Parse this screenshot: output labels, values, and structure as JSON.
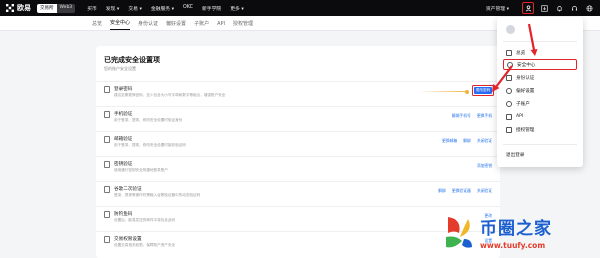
{
  "colors": {
    "accent_red": "#e1252a",
    "link_blue": "#1f6feb",
    "topbar_bg": "#0b0b0d",
    "brand_blue": "#1b5fd0",
    "brand_red": "#e53b2a"
  },
  "topbar": {
    "logo_text": "欧易",
    "pills": [
      "交易所",
      "Web3"
    ],
    "nav": [
      "买币",
      "发现 ▾",
      "交易 ▾",
      "金融服务 ▾",
      "OKC",
      "新手学院",
      "更多 ▾"
    ],
    "asset_management": "资产管理 ▾",
    "icons": [
      "user-icon",
      "download-icon",
      "bell-icon",
      "headset-icon",
      "globe-icon"
    ]
  },
  "subnav": {
    "tabs": [
      "总览",
      "安全中心",
      "身份认证",
      "偏好设置",
      "子账户",
      "API",
      "授权管理"
    ],
    "active_index": 1
  },
  "main": {
    "title": "已完成安全设置项",
    "subtitle": "您的账户安全设置",
    "rows": [
      {
        "title": "登录密码",
        "desc": "建议定期更换密码，至少包含大小写字母和数字等组合，增强账户安全",
        "actions": [],
        "button": "更改密码"
      },
      {
        "title": "手机验证",
        "desc": "用于登录、提现、修改安全设置时验证身份",
        "actions": [
          "解绑手机号",
          "更换手机"
        ],
        "button": ""
      },
      {
        "title": "邮箱验证",
        "desc": "用于登录、提现、修改安全设置时接收验证码",
        "actions": [
          "更换邮箱",
          "解绑",
          "关闭验证"
        ],
        "button": ""
      },
      {
        "title": "密钥验证",
        "desc": "使用通行密钥安全快捷地登录账户",
        "actions": [
          "添加密钥"
        ],
        "button": ""
      },
      {
        "title": "谷歌二次验证",
        "desc": "登录、提现等操作时需输入谷歌验证器中的动态验证码",
        "actions": [
          "解绑",
          "更换验证器",
          "关闭验证"
        ],
        "button": ""
      },
      {
        "title": "防钓鱼码",
        "desc": "设置后，欧易发送的邮件中将包含此码",
        "actions": [
          "更改"
        ],
        "button": ""
      },
      {
        "title": "交易权限设置",
        "desc": "设置交易相关权限，保障账户资产安全",
        "actions": [
          "设置"
        ],
        "button": ""
      }
    ]
  },
  "dropdown": {
    "items": [
      {
        "icon": "overview-icon",
        "label": "总览"
      },
      {
        "icon": "shield-icon",
        "label": "安全中心"
      },
      {
        "icon": "id-card-icon",
        "label": "身份认证"
      },
      {
        "icon": "settings-icon",
        "label": "偏好设置"
      },
      {
        "icon": "sub-account-icon",
        "label": "子账户"
      },
      {
        "icon": "api-icon",
        "label": "API"
      },
      {
        "icon": "authorization-icon",
        "label": "授权管理"
      }
    ],
    "highlight_index": 1,
    "logout": "退出登录"
  },
  "watermark": {
    "name": "币圈之家",
    "url": "www.tuufy.com"
  }
}
